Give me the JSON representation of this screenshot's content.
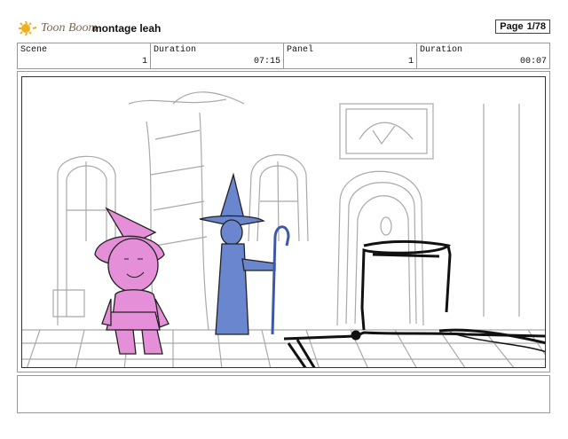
{
  "header": {
    "logo_text": "Toon Boom",
    "project_title": "montage leah",
    "page_label": "Page",
    "page_value": "1/78"
  },
  "info": {
    "scene_label": "Scene",
    "scene_value": "1",
    "scene_duration_label": "Duration",
    "scene_duration_value": "07:15",
    "panel_label": "Panel",
    "panel_value": "1",
    "panel_duration_label": "Duration",
    "panel_duration_value": "00:07"
  },
  "colors": {
    "witch_pink": "#e58fd8",
    "wizard_blue": "#6a86cf",
    "sketch_gray": "#a9a9a9",
    "ink_black": "#111111"
  }
}
